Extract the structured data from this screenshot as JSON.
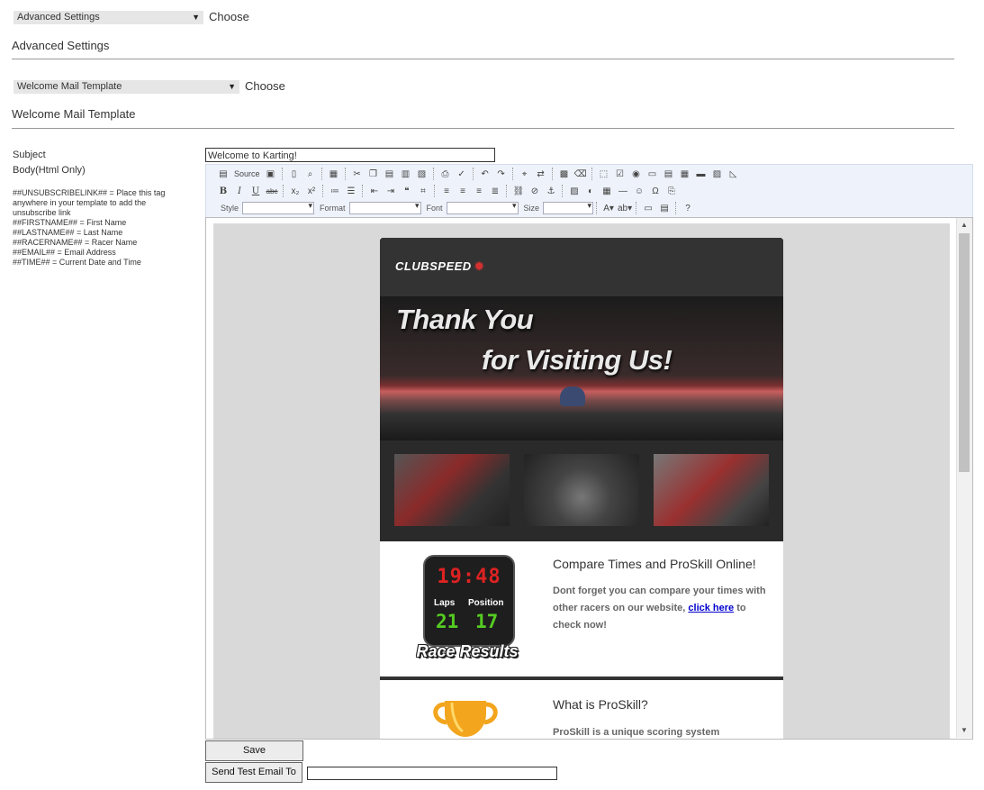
{
  "settings_select": {
    "value": "Advanced Settings",
    "choose": "Choose",
    "title": "Advanced Settings"
  },
  "template_select": {
    "value": "Welcome Mail Template",
    "choose": "Choose",
    "title": "Welcome Mail Template"
  },
  "form": {
    "subject_label": "Subject",
    "body_label": "Body(Html Only)",
    "subject_value": "Welcome to Karting!",
    "help": [
      "##UNSUBSCRIBELINK## = Place this tag anywhere in your template to add the unsubscribe link",
      "##FIRSTNAME## = First Name",
      "##LASTNAME## = Last Name",
      "##RACERNAME## = Racer Name",
      "##EMAIL## = Email Address",
      "##TIME## = Current Date and Time"
    ]
  },
  "toolbar": {
    "source": "Source",
    "style": "Style",
    "format": "Format",
    "font": "Font",
    "size": "Size"
  },
  "email": {
    "brand": "CLUBSPEED",
    "hero_line1": "Thank You",
    "hero_line2": "for Visiting Us!",
    "section1": {
      "heading": "Compare Times and ProSkill Online!",
      "text_before": "Dont forget you can compare your times with other racers on our website,",
      "link": "click here",
      "text_after": "to check now!"
    },
    "race_results": {
      "time": "19:48",
      "laps_label": "Laps",
      "position_label": "Position",
      "laps": "21",
      "position": "17",
      "caption": "Race Results"
    },
    "section2": {
      "heading": "What is ProSkill?",
      "text": "ProSkill is a unique scoring system developed"
    }
  },
  "actions": {
    "save": "Save",
    "send_test": "Send Test Email To",
    "test_email_value": ""
  }
}
